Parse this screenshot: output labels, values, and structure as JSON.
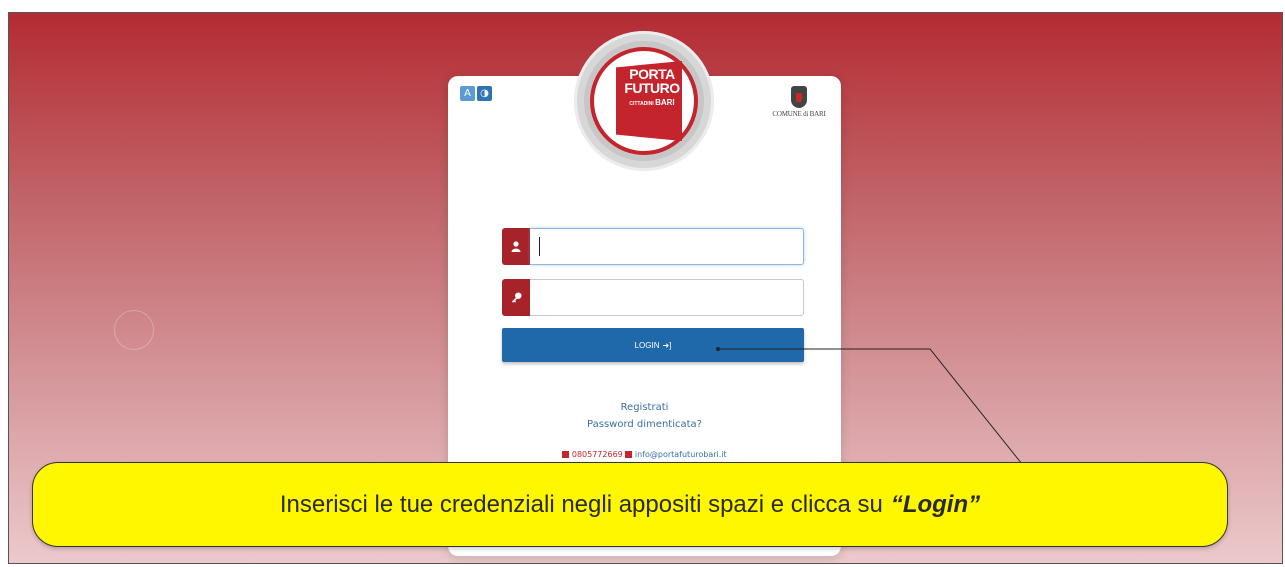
{
  "accessibility": {
    "font_label": "A",
    "contrast_label": "◑"
  },
  "logo": {
    "line1": "PORTA",
    "line2": "FUTURO",
    "line3a": "CITTADINI",
    "line3b": "BARI"
  },
  "comune": {
    "label": "COMUNE di BARI"
  },
  "login_form": {
    "username_icon": "user-icon",
    "username_value": "",
    "password_icon": "key-icon",
    "password_value": "",
    "login_label": "LOGIN",
    "login_icon": "sign-in-icon"
  },
  "links": {
    "register": "Registrati",
    "forgot_password": "Password dimenticata?"
  },
  "contacts": {
    "phone": "0805772669",
    "email": "info@portafuturobari.it"
  },
  "callout": {
    "text": "Inserisci le tue credenziali negli appositi spazi e clicca su",
    "highlight": "“Login”",
    "color": "#fff700"
  },
  "colors": {
    "brand_red": "#c4242b",
    "button_blue": "#1f69aa",
    "link_blue": "#3b6ea5"
  }
}
